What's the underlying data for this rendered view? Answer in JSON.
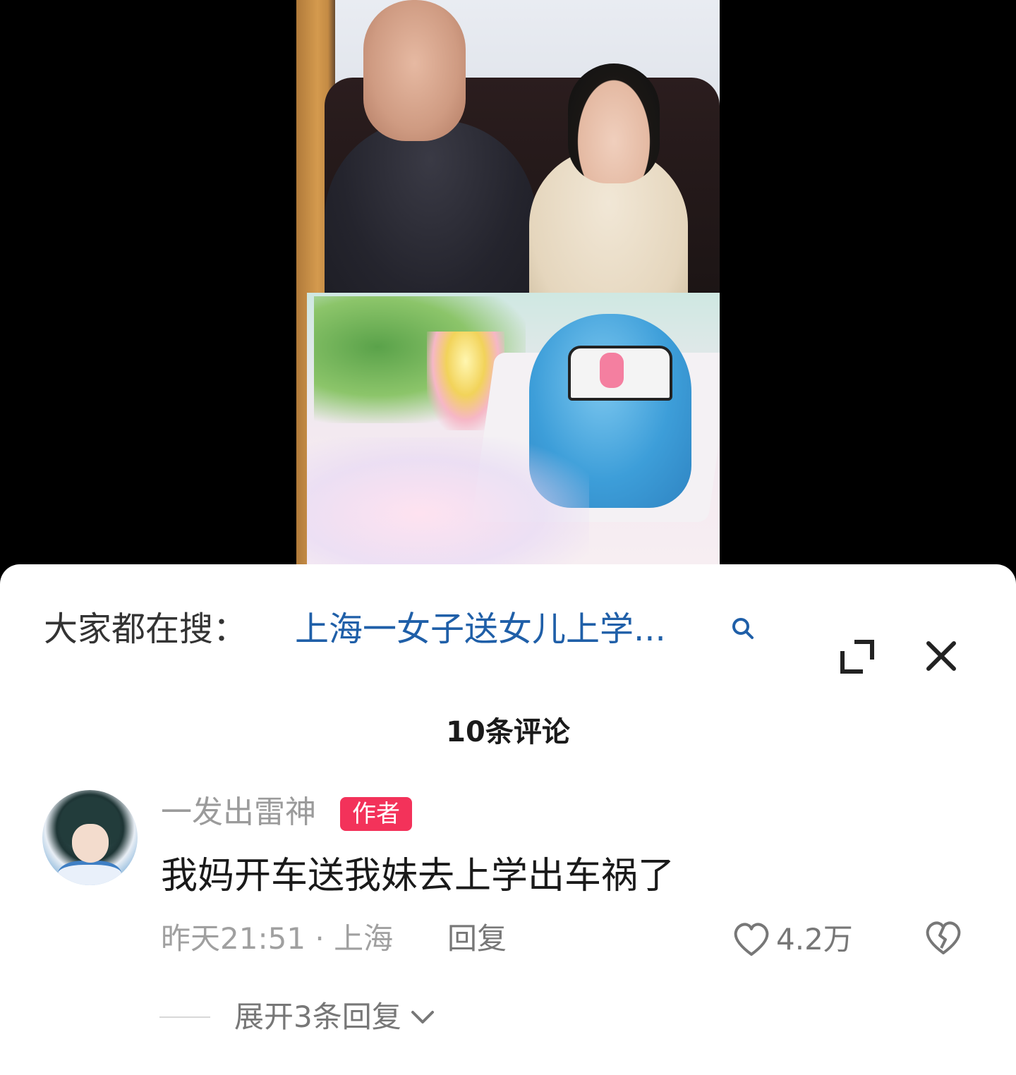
{
  "search_bar": {
    "prefix": "大家都在搜：",
    "query": "上海一女子送女儿上学..."
  },
  "comments_header": {
    "count_label": "10条评论"
  },
  "comment": {
    "username": "一发出雷神",
    "badge": "作者",
    "text": "我妈开车送我妹去上学出车祸了",
    "meta": "昨天21:51 · 上海",
    "reply_label": "回复",
    "likes": "4.2万",
    "expand_replies_label": "展开3条回复"
  },
  "colors": {
    "link": "#1f5fa8",
    "badge": "#f3325a",
    "muted_text": "#9b9b9b"
  },
  "icons": [
    "search-icon",
    "expand-icon",
    "close-icon",
    "heart-icon",
    "broken-heart-icon",
    "chevron-down-icon"
  ]
}
